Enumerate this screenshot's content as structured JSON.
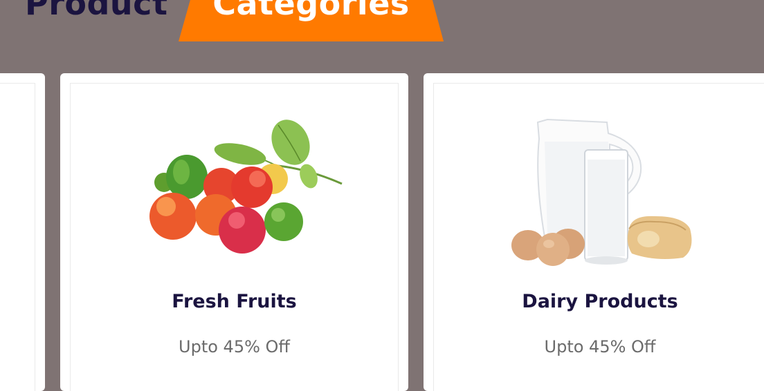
{
  "heading": {
    "plain": "Product",
    "highlight": "Categories"
  },
  "colors": {
    "background": "#7f7373",
    "accent": "#ff7a00",
    "title": "#1b1440",
    "subtitle": "#6b6b6b"
  },
  "categories": [
    {
      "title": "Fresh Fruits",
      "offer": "Upto 45% Off",
      "image": "fruits-image"
    },
    {
      "title": "Dairy Products",
      "offer": "Upto 45% Off",
      "image": "dairy-image"
    }
  ]
}
